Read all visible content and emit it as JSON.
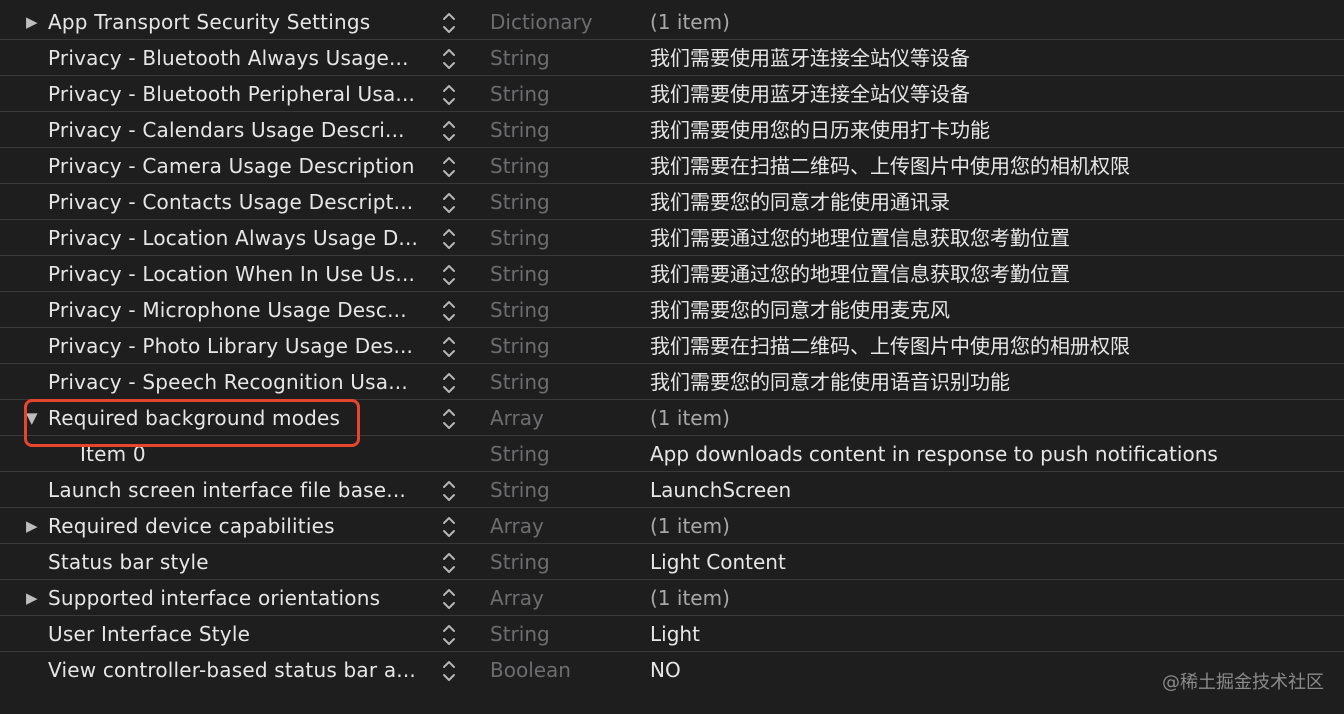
{
  "rows": [
    {
      "disclosure": "collapsed",
      "key": "App Transport Security Settings",
      "type": "Dictionary",
      "value": "(1 item)",
      "muted": true,
      "stepper": true
    },
    {
      "disclosure": "none",
      "key": "Privacy - Bluetooth Always Usage...",
      "type": "String",
      "value": "我们需要使用蓝牙连接全站仪等设备",
      "muted": false,
      "stepper": true
    },
    {
      "disclosure": "none",
      "key": "Privacy - Bluetooth Peripheral Usa...",
      "type": "String",
      "value": "我们需要使用蓝牙连接全站仪等设备",
      "muted": false,
      "stepper": true
    },
    {
      "disclosure": "none",
      "key": "Privacy - Calendars Usage Descri...",
      "type": "String",
      "value": "我们需要使用您的日历来使用打卡功能",
      "muted": false,
      "stepper": true
    },
    {
      "disclosure": "none",
      "key": "Privacy - Camera Usage Description",
      "type": "String",
      "value": "我们需要在扫描二维码、上传图片中使用您的相机权限",
      "muted": false,
      "stepper": true
    },
    {
      "disclosure": "none",
      "key": "Privacy - Contacts Usage Descript...",
      "type": "String",
      "value": "我们需要您的同意才能使用通讯录",
      "muted": false,
      "stepper": true
    },
    {
      "disclosure": "none",
      "key": "Privacy - Location Always Usage D...",
      "type": "String",
      "value": "我们需要通过您的地理位置信息获取您考勤位置",
      "muted": false,
      "stepper": true
    },
    {
      "disclosure": "none",
      "key": "Privacy - Location When In Use Us...",
      "type": "String",
      "value": "我们需要通过您的地理位置信息获取您考勤位置",
      "muted": false,
      "stepper": true
    },
    {
      "disclosure": "none",
      "key": "Privacy - Microphone Usage Desc...",
      "type": "String",
      "value": "我们需要您的同意才能使用麦克风",
      "muted": false,
      "stepper": true
    },
    {
      "disclosure": "none",
      "key": "Privacy - Photo Library Usage Des...",
      "type": "String",
      "value": "我们需要在扫描二维码、上传图片中使用您的相册权限",
      "muted": false,
      "stepper": true
    },
    {
      "disclosure": "none",
      "key": "Privacy - Speech Recognition Usa...",
      "type": "String",
      "value": "我们需要您的同意才能使用语音识别功能",
      "muted": false,
      "stepper": true
    },
    {
      "disclosure": "expanded",
      "key": "Required background modes",
      "type": "Array",
      "value": "(1 item)",
      "muted": true,
      "stepper": true
    },
    {
      "disclosure": "none",
      "child": true,
      "key": "Item 0",
      "type": "String",
      "value": "App downloads content in response to push notifications",
      "muted": false,
      "stepper": false
    },
    {
      "disclosure": "none",
      "key": "Launch screen interface file base...",
      "type": "String",
      "value": "LaunchScreen",
      "muted": false,
      "stepper": true
    },
    {
      "disclosure": "collapsed",
      "key": "Required device capabilities",
      "type": "Array",
      "value": "(1 item)",
      "muted": true,
      "stepper": true
    },
    {
      "disclosure": "none",
      "key": "Status bar style",
      "type": "String",
      "value": "Light Content",
      "muted": false,
      "stepper": true
    },
    {
      "disclosure": "collapsed",
      "key": "Supported interface orientations",
      "type": "Array",
      "value": "(1 item)",
      "muted": true,
      "stepper": true
    },
    {
      "disclosure": "none",
      "key": "User Interface Style",
      "type": "String",
      "value": "Light",
      "muted": false,
      "stepper": true
    },
    {
      "disclosure": "none",
      "key": "View controller-based status bar a...",
      "type": "Boolean",
      "value": "NO",
      "muted": false,
      "stepper": true
    }
  ],
  "icons": {
    "collapsed": "disclosure-right-icon",
    "expanded": "disclosure-down-icon",
    "stepper": "up-down-chevron-icon"
  },
  "colors": {
    "highlight": "#e8452f",
    "background": "#1e1e1f",
    "type_text": "#6d6d70"
  },
  "watermark": "@稀土掘金技术社区"
}
